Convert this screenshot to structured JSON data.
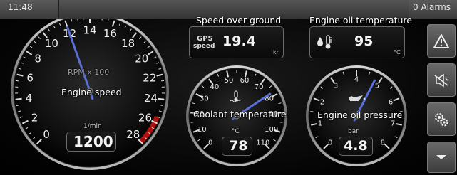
{
  "status_bar": {
    "time": "11:48",
    "alarms": "0 Alarms"
  },
  "rpm_gauge": {
    "label": "Engine speed",
    "scale_label": "RPM x 100",
    "unit": "1/min",
    "value": "1200",
    "value_number": 1200,
    "ticks": [
      "0",
      "2",
      "4",
      "6",
      "8",
      "10",
      "12",
      "14",
      "16",
      "18",
      "20",
      "22",
      "24",
      "26",
      "28"
    ]
  },
  "coolant_gauge": {
    "label": "Coolant temperature",
    "unit": "°C",
    "value": "78",
    "value_number": 78,
    "ticks": [
      "0",
      "10",
      "20",
      "30",
      "40",
      "50",
      "60",
      "70",
      "80",
      "90",
      "100",
      "110"
    ]
  },
  "oil_pressure_gauge": {
    "label": "Engine oil pressure",
    "unit": "bar",
    "value": "4.8",
    "value_number": 4.8,
    "ticks": [
      "0",
      "1",
      "2",
      "3",
      "4",
      "5",
      "6",
      "7",
      "8"
    ]
  },
  "speed_panel": {
    "title": "Speed over ground",
    "source_line1": "GPS",
    "source_line2": "speed",
    "value": "19.4",
    "unit": "kn"
  },
  "oil_temp_panel": {
    "title": "Engine oil temperature",
    "value": "95",
    "unit": "°C"
  },
  "side_buttons": [
    {
      "icon": "warning-icon"
    },
    {
      "icon": "alarm-mute-icon"
    },
    {
      "icon": "settings-icon"
    },
    {
      "icon": "chevron-down-icon"
    }
  ],
  "colors": {
    "needle": "#5a6fd8",
    "redline": "#b01010",
    "bezel": "#9a9a9a"
  }
}
